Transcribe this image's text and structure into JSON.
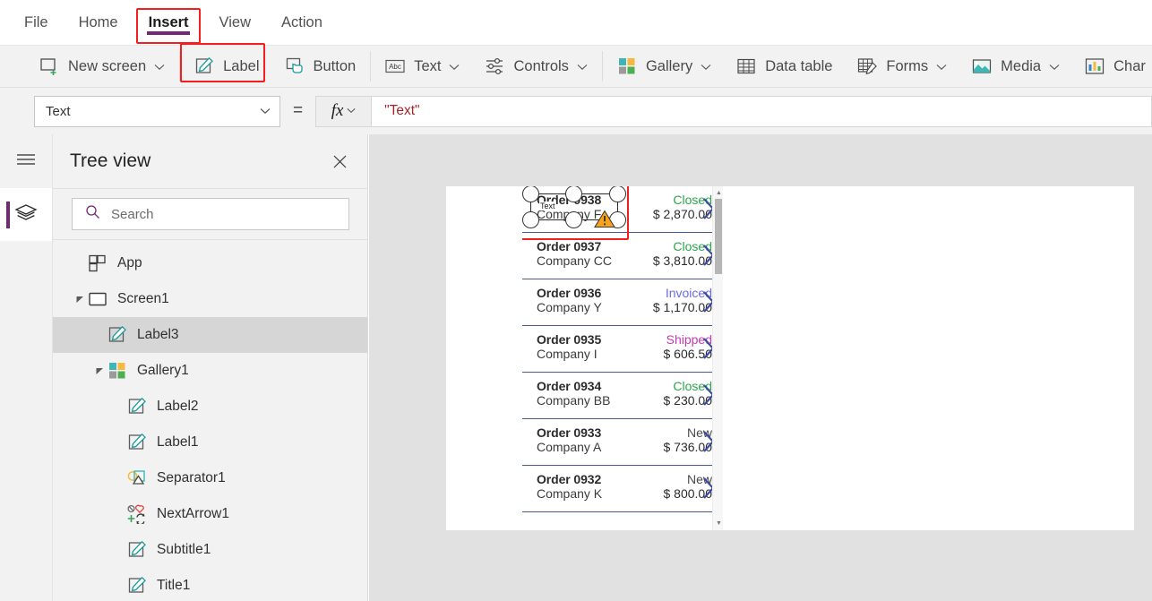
{
  "menu": {
    "items": [
      {
        "label": "File",
        "active": false
      },
      {
        "label": "Home",
        "active": false
      },
      {
        "label": "Insert",
        "active": true
      },
      {
        "label": "View",
        "active": false
      },
      {
        "label": "Action",
        "active": false
      }
    ]
  },
  "ribbon": {
    "items": [
      {
        "label": "New screen",
        "icon": "new-screen-icon",
        "caret": true
      },
      {
        "label": "Label",
        "icon": "label-icon",
        "caret": false
      },
      {
        "label": "Button",
        "icon": "button-icon",
        "caret": false
      },
      {
        "label": "Text",
        "icon": "text-abc-icon",
        "caret": true
      },
      {
        "label": "Controls",
        "icon": "controls-sliders-icon",
        "caret": true
      },
      {
        "label": "Gallery",
        "icon": "gallery-icon",
        "caret": true
      },
      {
        "label": "Data table",
        "icon": "data-table-icon",
        "caret": false
      },
      {
        "label": "Forms",
        "icon": "forms-icon",
        "caret": true
      },
      {
        "label": "Media",
        "icon": "media-image-icon",
        "caret": true
      },
      {
        "label": "Char",
        "icon": "charts-icon",
        "caret": false
      }
    ]
  },
  "formula_bar": {
    "property": "Text",
    "equals": "=",
    "fx": "fx",
    "expression": "\"Text\""
  },
  "tree_view": {
    "title": "Tree view",
    "close_label": "✕",
    "search_placeholder": "Search",
    "search_value": "",
    "nodes": [
      {
        "label": "App",
        "icon": "app-icon",
        "indent": 0,
        "caret": "none",
        "selected": false
      },
      {
        "label": "Screen1",
        "icon": "screen-icon",
        "indent": 0,
        "caret": "expanded",
        "selected": false
      },
      {
        "label": "Label3",
        "icon": "label-icon",
        "indent": 1,
        "caret": "none",
        "selected": true
      },
      {
        "label": "Gallery1",
        "icon": "gallery-icon",
        "indent": 1,
        "caret": "expanded",
        "selected": false
      },
      {
        "label": "Label2",
        "icon": "label-icon",
        "indent": 2,
        "caret": "none",
        "selected": false
      },
      {
        "label": "Label1",
        "icon": "label-icon",
        "indent": 2,
        "caret": "none",
        "selected": false
      },
      {
        "label": "Separator1",
        "icon": "separator-icon",
        "indent": 2,
        "caret": "none",
        "selected": false
      },
      {
        "label": "NextArrow1",
        "icon": "next-arrow-icon",
        "indent": 2,
        "caret": "none",
        "selected": false
      },
      {
        "label": "Subtitle1",
        "icon": "label-icon",
        "indent": 2,
        "caret": "none",
        "selected": false
      },
      {
        "label": "Title1",
        "icon": "label-icon",
        "indent": 2,
        "caret": "none",
        "selected": false
      }
    ]
  },
  "canvas": {
    "selected_control": {
      "caption": "Text",
      "warning_icon": "warning-triangle-icon",
      "handles": 8
    },
    "gallery": {
      "rows": [
        {
          "title": "Order 0938",
          "subtitle": "Company F",
          "status": "Closed",
          "amount": "$ 2,870.00",
          "status_color": "#2aa64b"
        },
        {
          "title": "Order 0937",
          "subtitle": "Company CC",
          "status": "Closed",
          "amount": "$ 3,810.00",
          "status_color": "#2aa64b"
        },
        {
          "title": "Order 0936",
          "subtitle": "Company Y",
          "status": "Invoiced",
          "amount": "$ 1,170.00",
          "status_color": "#6a6ce0"
        },
        {
          "title": "Order 0935",
          "subtitle": "Company I",
          "status": "Shipped",
          "amount": "$ 606.50",
          "status_color": "#c23bb0"
        },
        {
          "title": "Order 0934",
          "subtitle": "Company BB",
          "status": "Closed",
          "amount": "$ 230.00",
          "status_color": "#2aa64b"
        },
        {
          "title": "Order 0933",
          "subtitle": "Company A",
          "status": "New",
          "amount": "$ 736.00",
          "status_color": "#4a4a4a"
        },
        {
          "title": "Order 0932",
          "subtitle": "Company K",
          "status": "New",
          "amount": "$ 800.00",
          "status_color": "#4a4a4a"
        }
      ],
      "scrollbar": {
        "up_arrow": "▲",
        "down_arrow": "▼"
      }
    }
  },
  "colors": {
    "accent_purple": "#742774",
    "highlight_red": "#f41e1e",
    "chevron_blue": "#3b4ba0",
    "formula_red": "#a4262c"
  }
}
